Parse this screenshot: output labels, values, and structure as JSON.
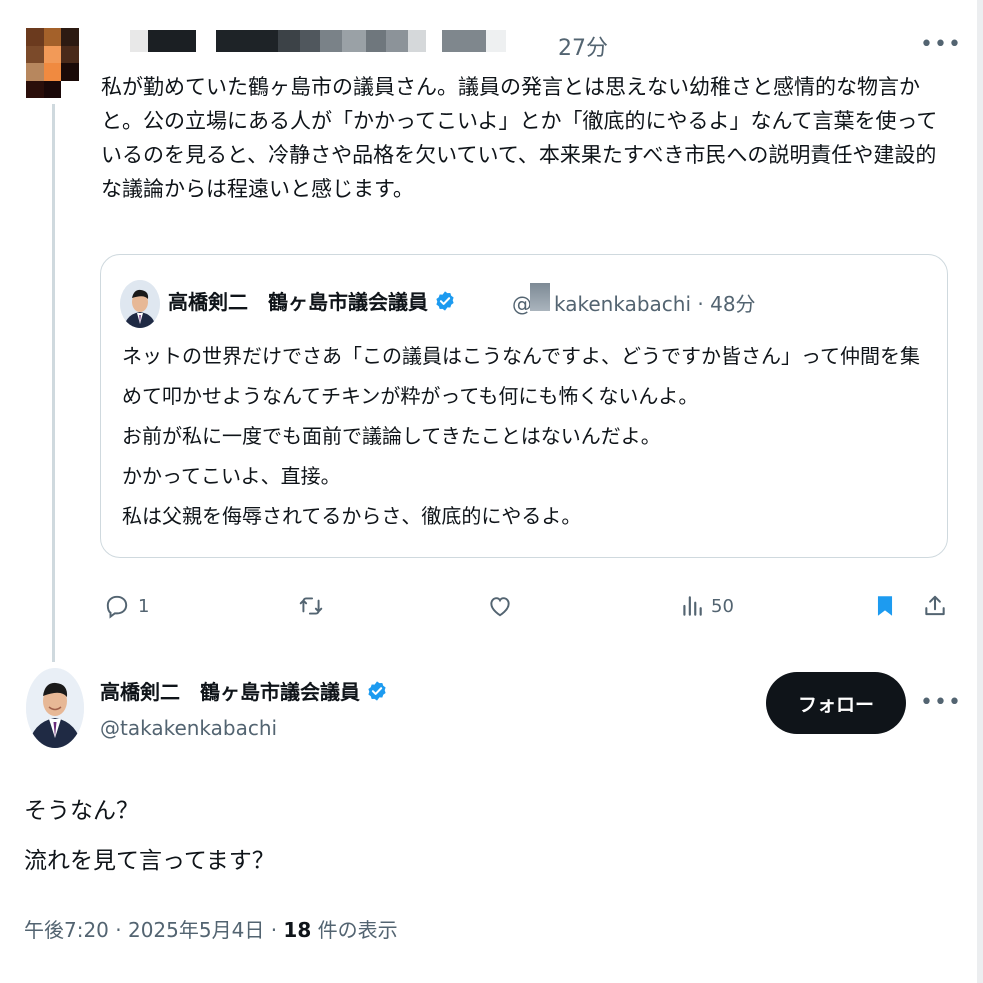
{
  "reply_tweet": {
    "time": "27分",
    "text": "私が勤めていた鶴ヶ島市の議員さん。議員の発言とは思えない幼稚さと感情的な物言かと。公の立場にある人が「かかってこいよ」とか「徹底的にやるよ」なんて言葉を使っているのを見ると、冷静さや品格を欠いていて、本来果たすべき市民への説明責任や建設的な議論からは程遠いと感じます。",
    "more_icon": "more-horizontal-icon"
  },
  "quoted_tweet": {
    "author_name": "高橋剣二　鶴ヶ島市議会議員",
    "handle_prefix": "@",
    "handle_rest": "kakenkabachi",
    "time": "· 48分",
    "text": "ネットの世界だけでさあ「この議員はこうなんですよ、どうですか皆さん」って仲間を集めて叩かせようなんてチキンが粋がっても何にも怖くないんよ。\nお前が私に一度でも面前で議論してきたことはないんだよ。\nかかってこいよ、直接。\n私は父親を侮辱されてるからさ、徹底的にやるよ。"
  },
  "actions": {
    "reply_count": "1",
    "views_count": "50",
    "icons": [
      "reply-icon",
      "retweet-icon",
      "like-icon",
      "views-icon",
      "bookmark-icon",
      "share-icon"
    ]
  },
  "main_tweet": {
    "author_name": "高橋剣二　鶴ヶ島市議会議員",
    "handle": "@takakenkabachi",
    "follow_label": "フォロー",
    "text": "そうなん？\n流れを見て言ってます？",
    "timestamp": "午後7:20 · 2025年5月4日 · ",
    "views_number": "18",
    "views_suffix": " 件の表示"
  },
  "colors": {
    "text": "#0f1419",
    "secondary": "#536471",
    "verified": "#1d9bf0",
    "bookmark": "#1d9bf0",
    "border": "#cfd9de"
  }
}
